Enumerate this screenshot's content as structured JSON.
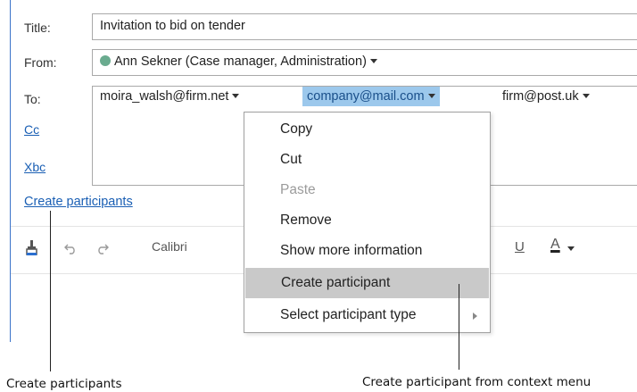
{
  "form": {
    "title_label": "Title:",
    "title_value": "Invitation to bid on tender",
    "from_label": "From:",
    "from_value": "Ann Sekner (Case manager, Administration)",
    "to_label": "To:",
    "cc_label": "Cc",
    "xbc_label": "Xbc",
    "create_participants_link": "Create participants",
    "recipients": [
      "moira_walsh@firm.net",
      "company@mail.com",
      "firm@post.uk"
    ],
    "selected_recipient_index": 1
  },
  "toolbar": {
    "font_name": "Calibri",
    "underline": "U",
    "font_color": "A"
  },
  "context_menu": {
    "items": [
      {
        "label": "Copy",
        "enabled": true
      },
      {
        "label": "Cut",
        "enabled": true
      },
      {
        "label": "Paste",
        "enabled": false
      },
      {
        "label": "Remove",
        "enabled": true
      },
      {
        "label": "Show more information",
        "enabled": true
      },
      {
        "label": "Create participant",
        "enabled": true,
        "highlighted": true
      },
      {
        "label": "Select participant type",
        "enabled": true,
        "submenu": true
      }
    ]
  },
  "callouts": {
    "left": "Create participants",
    "right": "Create participant from context menu"
  },
  "colors": {
    "link": "#1a5fb4",
    "selected_chip_bg": "#9cc8ec",
    "menu_highlight": "#c9c9c9",
    "status_dot": "#6aab8f"
  }
}
